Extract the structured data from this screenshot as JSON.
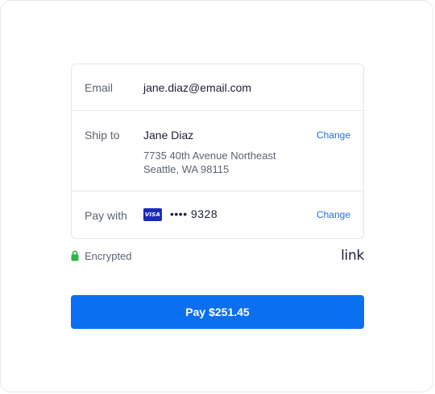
{
  "email": {
    "label": "Email",
    "value": "jane.diaz@email.com"
  },
  "ship": {
    "label": "Ship to",
    "name": "Jane Diaz",
    "address_line1": "7735 40th Avenue Northeast",
    "address_line2": "Seattle, WA 98115",
    "change_label": "Change"
  },
  "payment": {
    "label": "Pay with",
    "card_brand": "VISA",
    "card_masked": "•••• 9328",
    "change_label": "Change"
  },
  "security": {
    "encrypted_label": "Encrypted",
    "lock_icon": "lock-icon",
    "lock_color": "#2fb344"
  },
  "brand": {
    "logo_text": "link"
  },
  "pay_button": {
    "label": "Pay $251.45",
    "color": "#0a6ff0"
  }
}
